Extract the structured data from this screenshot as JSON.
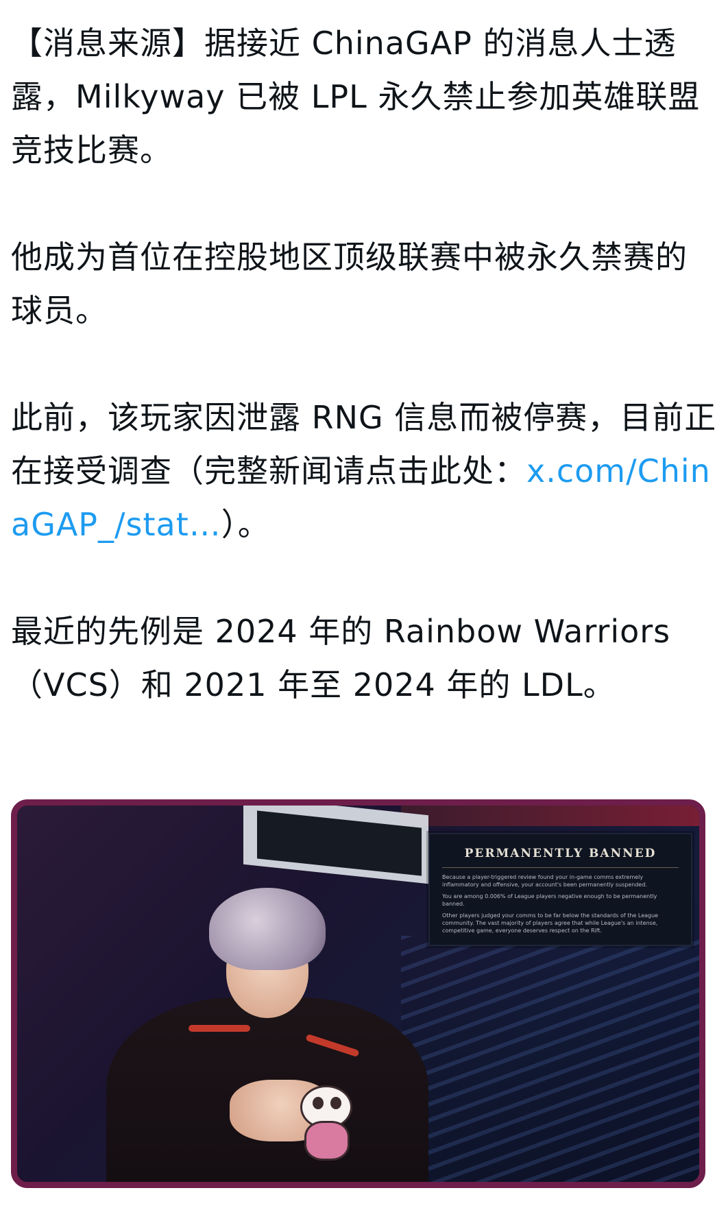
{
  "post": {
    "p1": "【消息来源】据接近 ChinaGAP 的消息人士透露，Milkyway 已被 LPL 永久禁止参加英雄联盟竞技比赛。",
    "p2": "他成为首位在控股地区顶级联赛中被永久禁赛的球员。",
    "p3_before": "此前，该玩家因泄露 RNG 信息而被停赛，目前正在接受调查（完整新闻请点击此处：",
    "p3_link": "x.com/ChinaGAP_/stat…",
    "p3_after": "）。",
    "p4": "最近的先例是 2024 年的 Rainbow Warriors（VCS）和 2021 年至 2024 年的 LDL。"
  },
  "image": {
    "banner_title": "PERMANENTLY BANNED",
    "banner_line1": "Because a player-triggered review found your in-game comms extremely inflammatory and offensive, your account's been permanently suspended.",
    "banner_line2": "You are among 0.006% of League players negative enough to be permanently banned.",
    "banner_line3": "Other players judged your comms to be far below the standards of the League community. The vast majority of players agree that while League's an intense, competitive game, everyone deserves respect on the Rift."
  },
  "colors": {
    "text": "#0f1419",
    "link": "#1d9bf0",
    "card_border": "#6e1e4a"
  }
}
